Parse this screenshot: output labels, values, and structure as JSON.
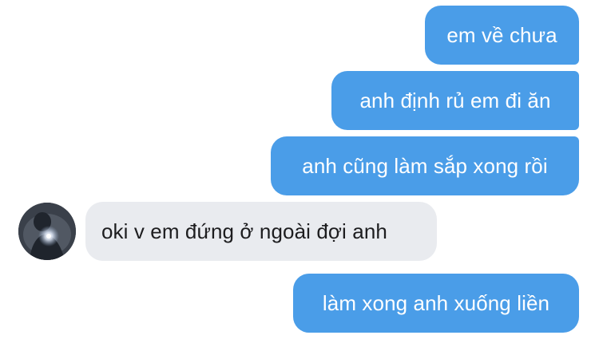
{
  "messages": [
    {
      "sender": "me",
      "text": "em về chưa"
    },
    {
      "sender": "me",
      "text": "anh định rủ em đi ăn"
    },
    {
      "sender": "me",
      "text": "anh cũng làm sắp xong rồi"
    },
    {
      "sender": "other",
      "text": "oki v em đứng ở ngoài đợi anh"
    },
    {
      "sender": "me",
      "text": "làm xong anh xuống liền"
    }
  ],
  "colors": {
    "outgoing_bubble": "#4a9de8",
    "incoming_bubble": "#e9ebef",
    "outgoing_text": "#ffffff",
    "incoming_text": "#1d1d1f"
  },
  "icons": {
    "avatar": "contact-avatar-photo"
  }
}
